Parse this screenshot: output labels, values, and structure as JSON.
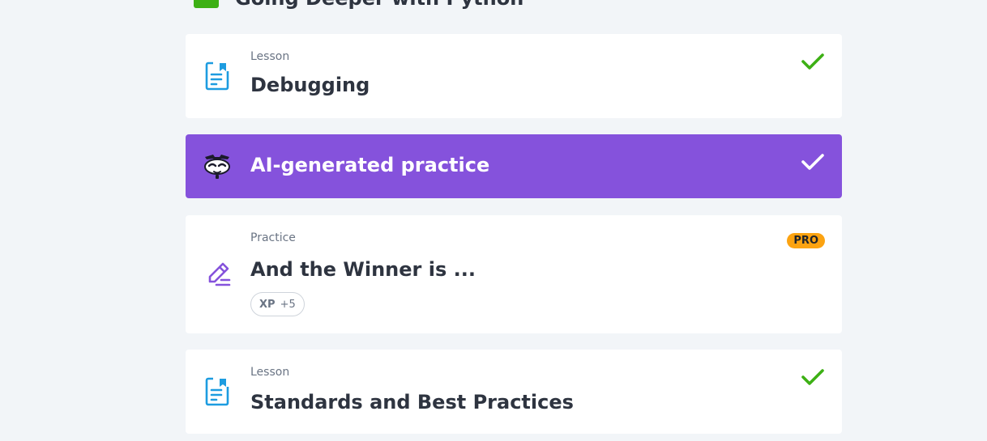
{
  "section": {
    "title": "Going Deeper with Python"
  },
  "colors": {
    "page_bg": "#f2f5f8",
    "card_bg": "#ffffff",
    "ai_bg": "#8552dc",
    "check_green": "#3db015",
    "lesson_icon_blue": "#1d9ce0",
    "practice_icon_purple": "#8552dc",
    "pro_badge": "#fca311"
  },
  "items": [
    {
      "kind": "Lesson",
      "title": "Debugging",
      "icon": "lesson-document-icon",
      "completed": true
    },
    {
      "kind": "",
      "title": "AI-generated practice",
      "icon": "ai-face-icon",
      "completed": true
    },
    {
      "kind": "Practice",
      "title": "And the Winner is ...",
      "icon": "practice-pencil-icon",
      "badge": "PRO",
      "xp_label": "XP",
      "xp_value": "+5",
      "completed": false
    },
    {
      "kind": "Lesson",
      "title": "Standards and Best Practices",
      "icon": "lesson-document-icon",
      "completed": true
    }
  ]
}
